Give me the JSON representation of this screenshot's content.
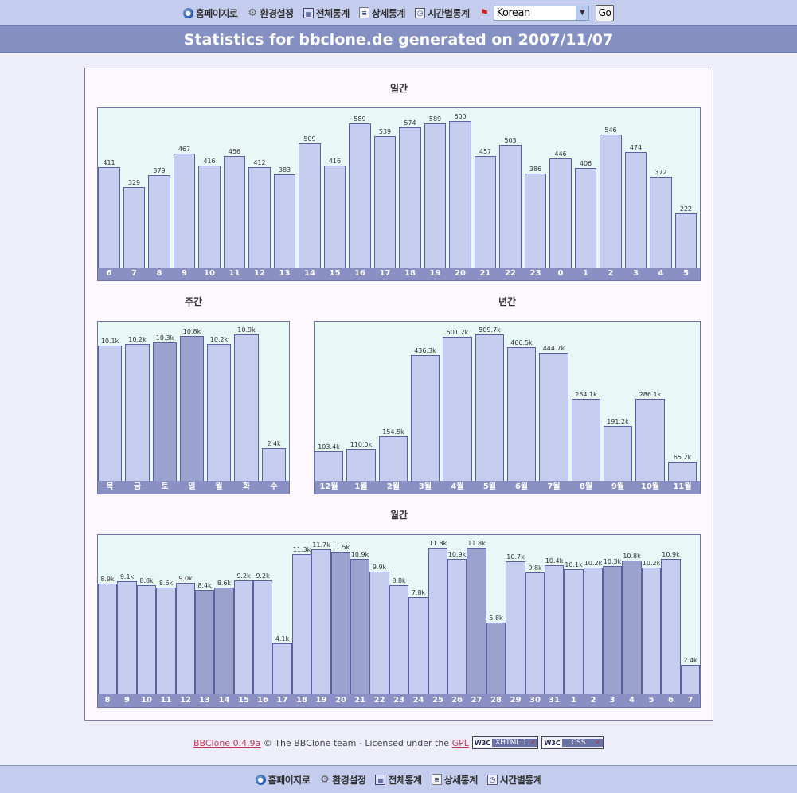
{
  "nav": [
    {
      "label": "홈페이지로",
      "icon": "home-globe-icon"
    },
    {
      "label": "환경설정",
      "icon": "gear-icon"
    },
    {
      "label": "전체통계",
      "icon": "chart-icon"
    },
    {
      "label": "상세통계",
      "icon": "document-icon"
    },
    {
      "label": "시간별통계",
      "icon": "clock-icon"
    }
  ],
  "language": {
    "selected": "Korean",
    "go_label": "Go",
    "flag_icon": "flag-icon"
  },
  "title": "Statistics for bbclone.de generated on 2007/11/07",
  "colors": {
    "bar": "#c6cdef",
    "bar_highlight": "#9aa3ce",
    "chart_bg": "#e7f8f6",
    "axis_bar": "#8a90c3",
    "header": "#8590c2"
  },
  "footer": {
    "link": "BBClone 0.4.9a",
    "text": " © The BBClone team - Licensed under the ",
    "license": "GPL",
    "badge1": {
      "w3": "W3C",
      "text": "XHTML 1"
    },
    "badge2": {
      "w3": "W3C",
      "text": "CSS"
    }
  },
  "chart_data": [
    {
      "type": "bar",
      "title": "일간",
      "categories": [
        "6",
        "7",
        "8",
        "9",
        "10",
        "11",
        "12",
        "13",
        "14",
        "15",
        "16",
        "17",
        "18",
        "19",
        "20",
        "21",
        "22",
        "23",
        "0",
        "1",
        "2",
        "3",
        "4",
        "5"
      ],
      "values": [
        411,
        329,
        379,
        467,
        416,
        456,
        412,
        383,
        509,
        416,
        589,
        539,
        574,
        589,
        600,
        457,
        503,
        386,
        446,
        406,
        546,
        474,
        372,
        222
      ],
      "labels": [
        "411",
        "329",
        "379",
        "467",
        "416",
        "456",
        "412",
        "383",
        "509",
        "416",
        "589",
        "539",
        "574",
        "589",
        "600",
        "457",
        "503",
        "386",
        "446",
        "406",
        "546",
        "474",
        "372",
        "222"
      ],
      "highlight": [],
      "ymax": 600
    },
    {
      "type": "bar",
      "title": "주간",
      "categories": [
        "목",
        "금",
        "토",
        "일",
        "월",
        "화",
        "수"
      ],
      "values": [
        10.1,
        10.2,
        10.3,
        10.8,
        10.2,
        10.9,
        2.4
      ],
      "labels": [
        "10.1k",
        "10.2k",
        "10.3k",
        "10.8k",
        "10.2k",
        "10.9k",
        "2.4k"
      ],
      "highlight": [
        2,
        3
      ],
      "ymax": 10.9
    },
    {
      "type": "bar",
      "title": "년간",
      "categories": [
        "12월",
        "1월",
        "2월",
        "3월",
        "4월",
        "5월",
        "6월",
        "7월",
        "8월",
        "9월",
        "10월",
        "11월"
      ],
      "values": [
        103.4,
        110.0,
        154.5,
        436.3,
        501.2,
        509.7,
        466.5,
        444.7,
        284.1,
        191.2,
        286.1,
        65.2
      ],
      "labels": [
        "103.4k",
        "110.0k",
        "154.5k",
        "436.3k",
        "501.2k",
        "509.7k",
        "466.5k",
        "444.7k",
        "284.1k",
        "191.2k",
        "286.1k",
        "65.2k"
      ],
      "highlight": [],
      "ymax": 509.7
    },
    {
      "type": "bar",
      "title": "월간",
      "categories": [
        "8",
        "9",
        "10",
        "11",
        "12",
        "13",
        "14",
        "15",
        "16",
        "17",
        "18",
        "19",
        "20",
        "21",
        "22",
        "23",
        "24",
        "25",
        "26",
        "27",
        "28",
        "29",
        "30",
        "31",
        "1",
        "2",
        "3",
        "4",
        "5",
        "6",
        "7"
      ],
      "values": [
        8.9,
        9.1,
        8.8,
        8.6,
        9.0,
        8.4,
        8.6,
        9.2,
        9.2,
        4.1,
        11.3,
        11.7,
        11.5,
        10.9,
        9.9,
        8.8,
        7.8,
        11.8,
        10.9,
        11.8,
        5.8,
        10.7,
        9.8,
        10.4,
        10.1,
        10.2,
        10.3,
        10.8,
        10.2,
        10.9,
        2.4
      ],
      "labels": [
        "8.9k",
        "9.1k",
        "8.8k",
        "8.6k",
        "9.0k",
        "8.4k",
        "8.6k",
        "9.2k",
        "9.2k",
        "4.1k",
        "11.3k",
        "11.7k",
        "11.5k",
        "10.9k",
        "9.9k",
        "8.8k",
        "7.8k",
        "11.8k",
        "10.9k",
        "11.8k",
        "5.8k",
        "10.7k",
        "9.8k",
        "10.4k",
        "10.1k",
        "10.2k",
        "10.3k",
        "10.8k",
        "10.2k",
        "10.9k",
        "2.4k"
      ],
      "highlight": [
        5,
        6,
        12,
        13,
        19,
        20,
        26,
        27
      ],
      "ymax": 11.8
    }
  ]
}
